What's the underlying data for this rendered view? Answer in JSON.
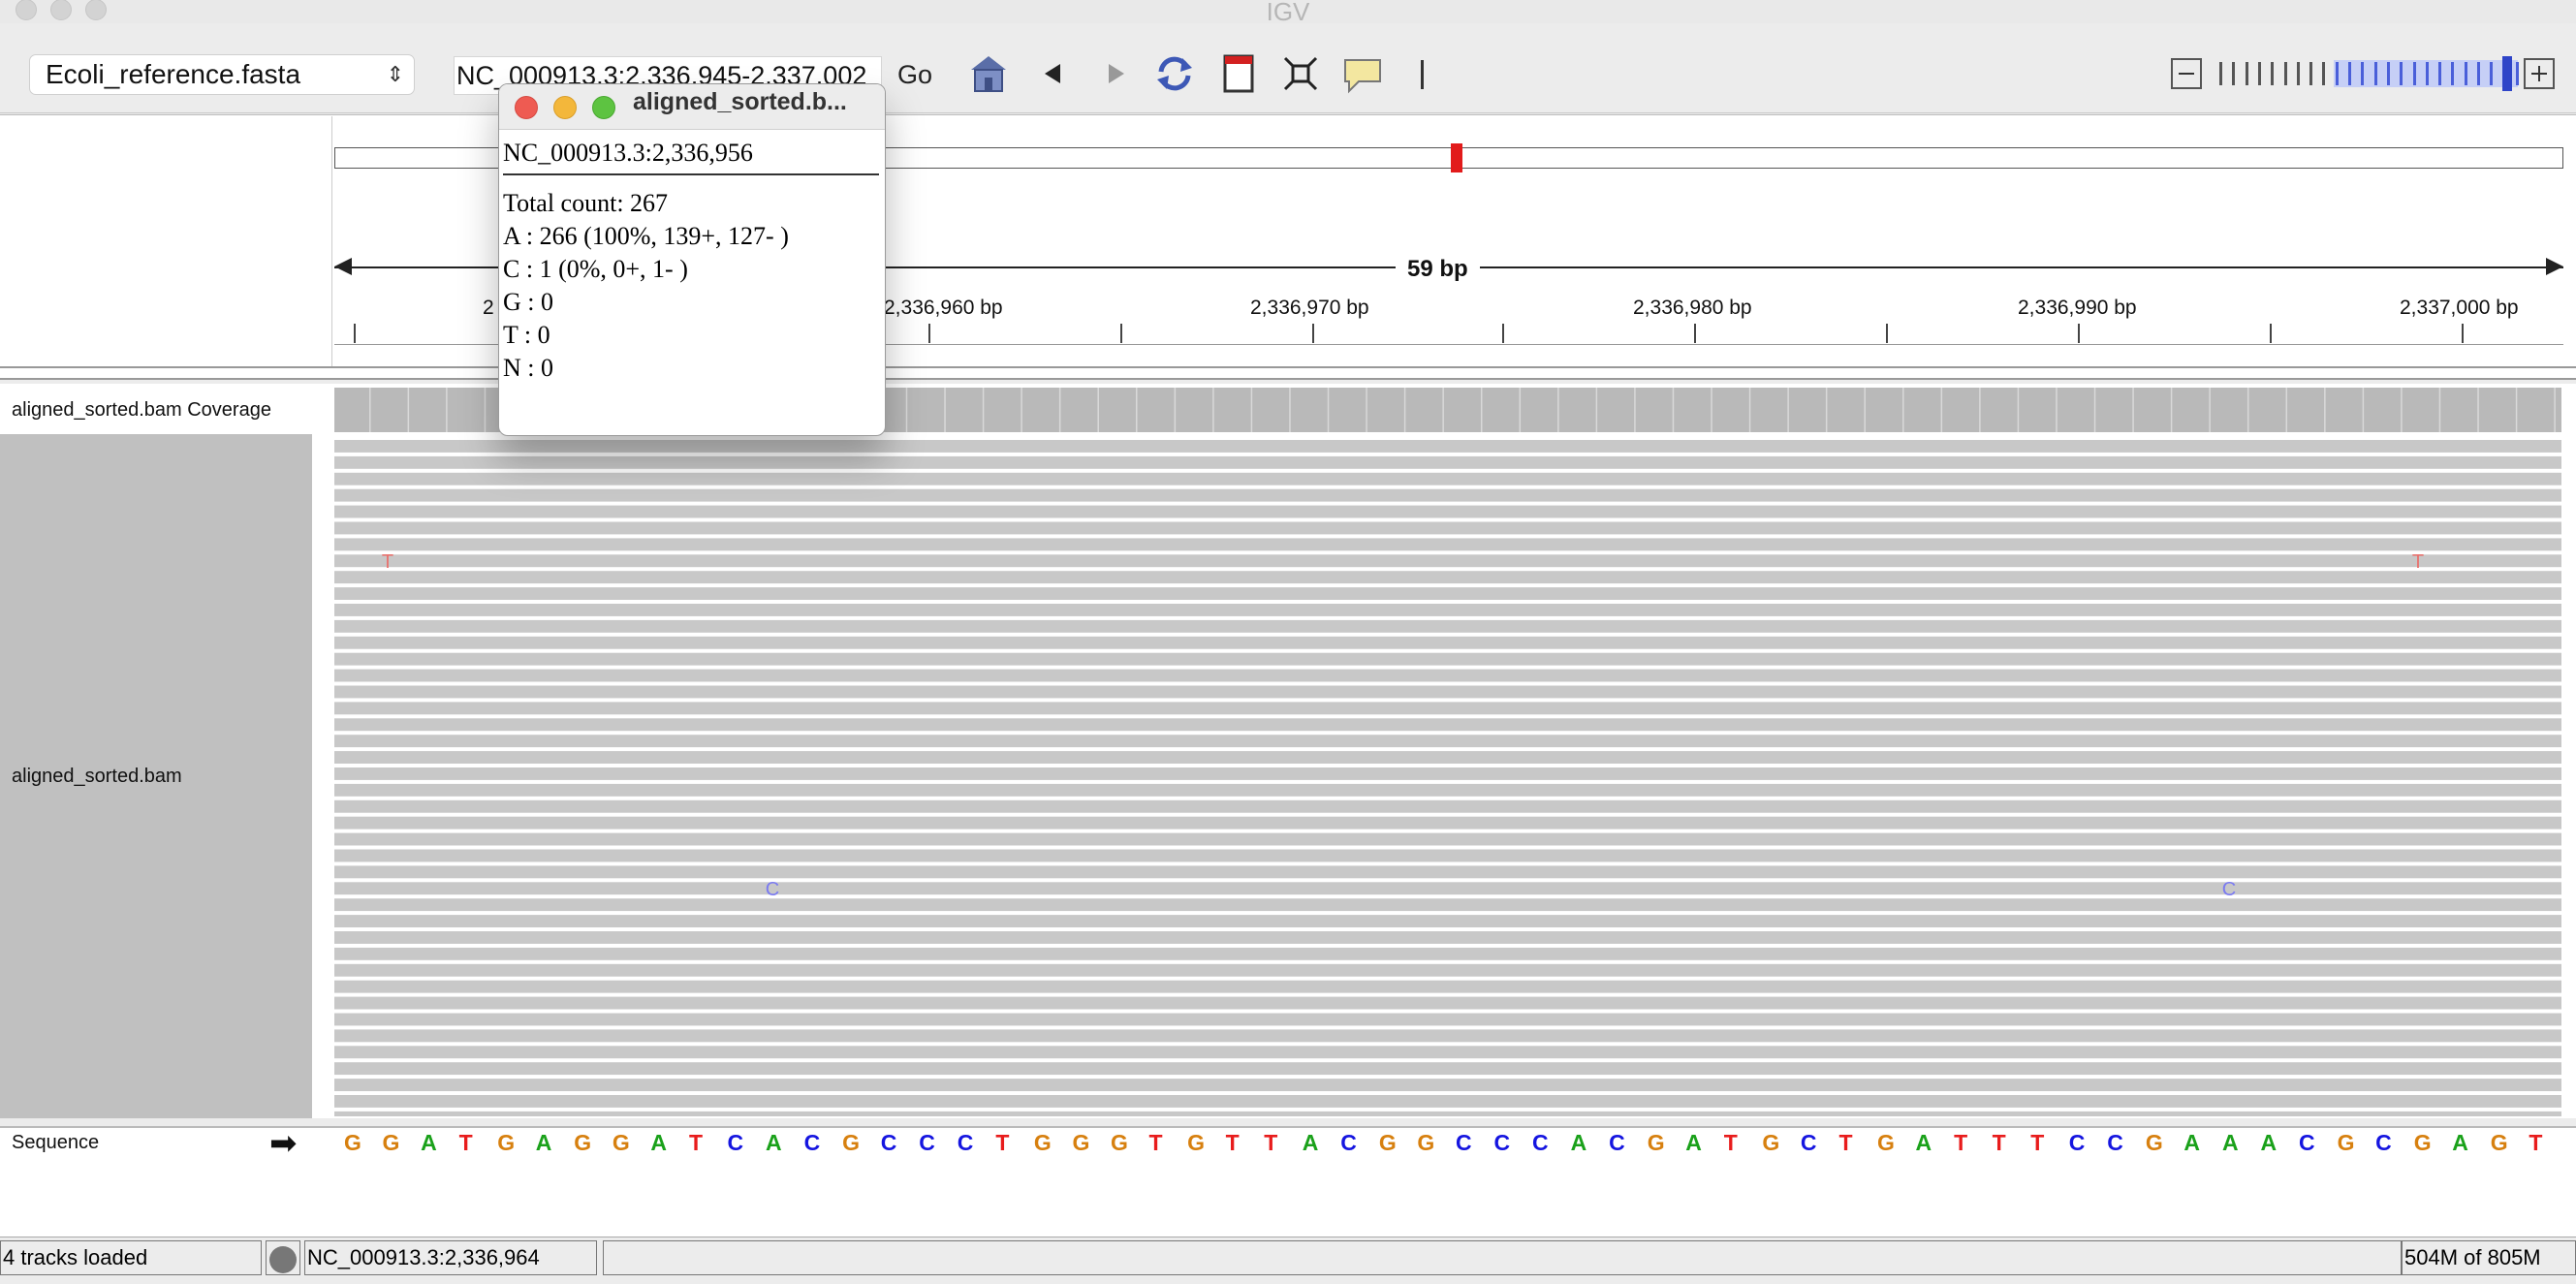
{
  "window": {
    "title": "IGV"
  },
  "toolbar": {
    "genome": "Ecoli_reference.fasta",
    "locus": "NC_000913.3:2,336,945-2,337,002",
    "go_label": "Go"
  },
  "ruler": {
    "span_label": "59 bp",
    "partial_left_label": "2",
    "ticks": [
      {
        "label": "2,336,960 bp"
      },
      {
        "label": "2,336,970 bp"
      },
      {
        "label": "2,336,980 bp"
      },
      {
        "label": "2,336,990 bp"
      },
      {
        "label": "2,337,000 bp"
      }
    ]
  },
  "tracks": {
    "coverage_name": "aligned_sorted.bam Coverage",
    "alignment_name": "aligned_sorted.bam",
    "sequence_name": "Sequence",
    "mismatches": [
      {
        "base": "T",
        "color": "#e8736f"
      },
      {
        "base": "T",
        "color": "#e8736f"
      },
      {
        "base": "C",
        "color": "#7b7bf0"
      },
      {
        "base": "C",
        "color": "#7b7bf0"
      }
    ]
  },
  "sequence": "GGATGAGGATCACGCCCTGGGTGTTACGGCCCACGATGCTGATTTCCGAAACGCGAGT",
  "base_colors": {
    "A": "#1aa11a",
    "C": "#1515e0",
    "G": "#d7800f",
    "T": "#e81c1c"
  },
  "popup": {
    "title": "aligned_sorted.b...",
    "locus": "NC_000913.3:2,336,956",
    "lines": [
      "Total count: 267",
      "A : 266 (100%, 139+, 127- )",
      "C : 1 (0%, 0+, 1- )",
      "G : 0",
      "T : 0",
      "N : 0"
    ]
  },
  "status": {
    "message": "4 tracks loaded",
    "position": "NC_000913.3:2,336,964",
    "memory": "504M of 805M"
  },
  "zoom": {
    "level_fraction": 0.88
  }
}
